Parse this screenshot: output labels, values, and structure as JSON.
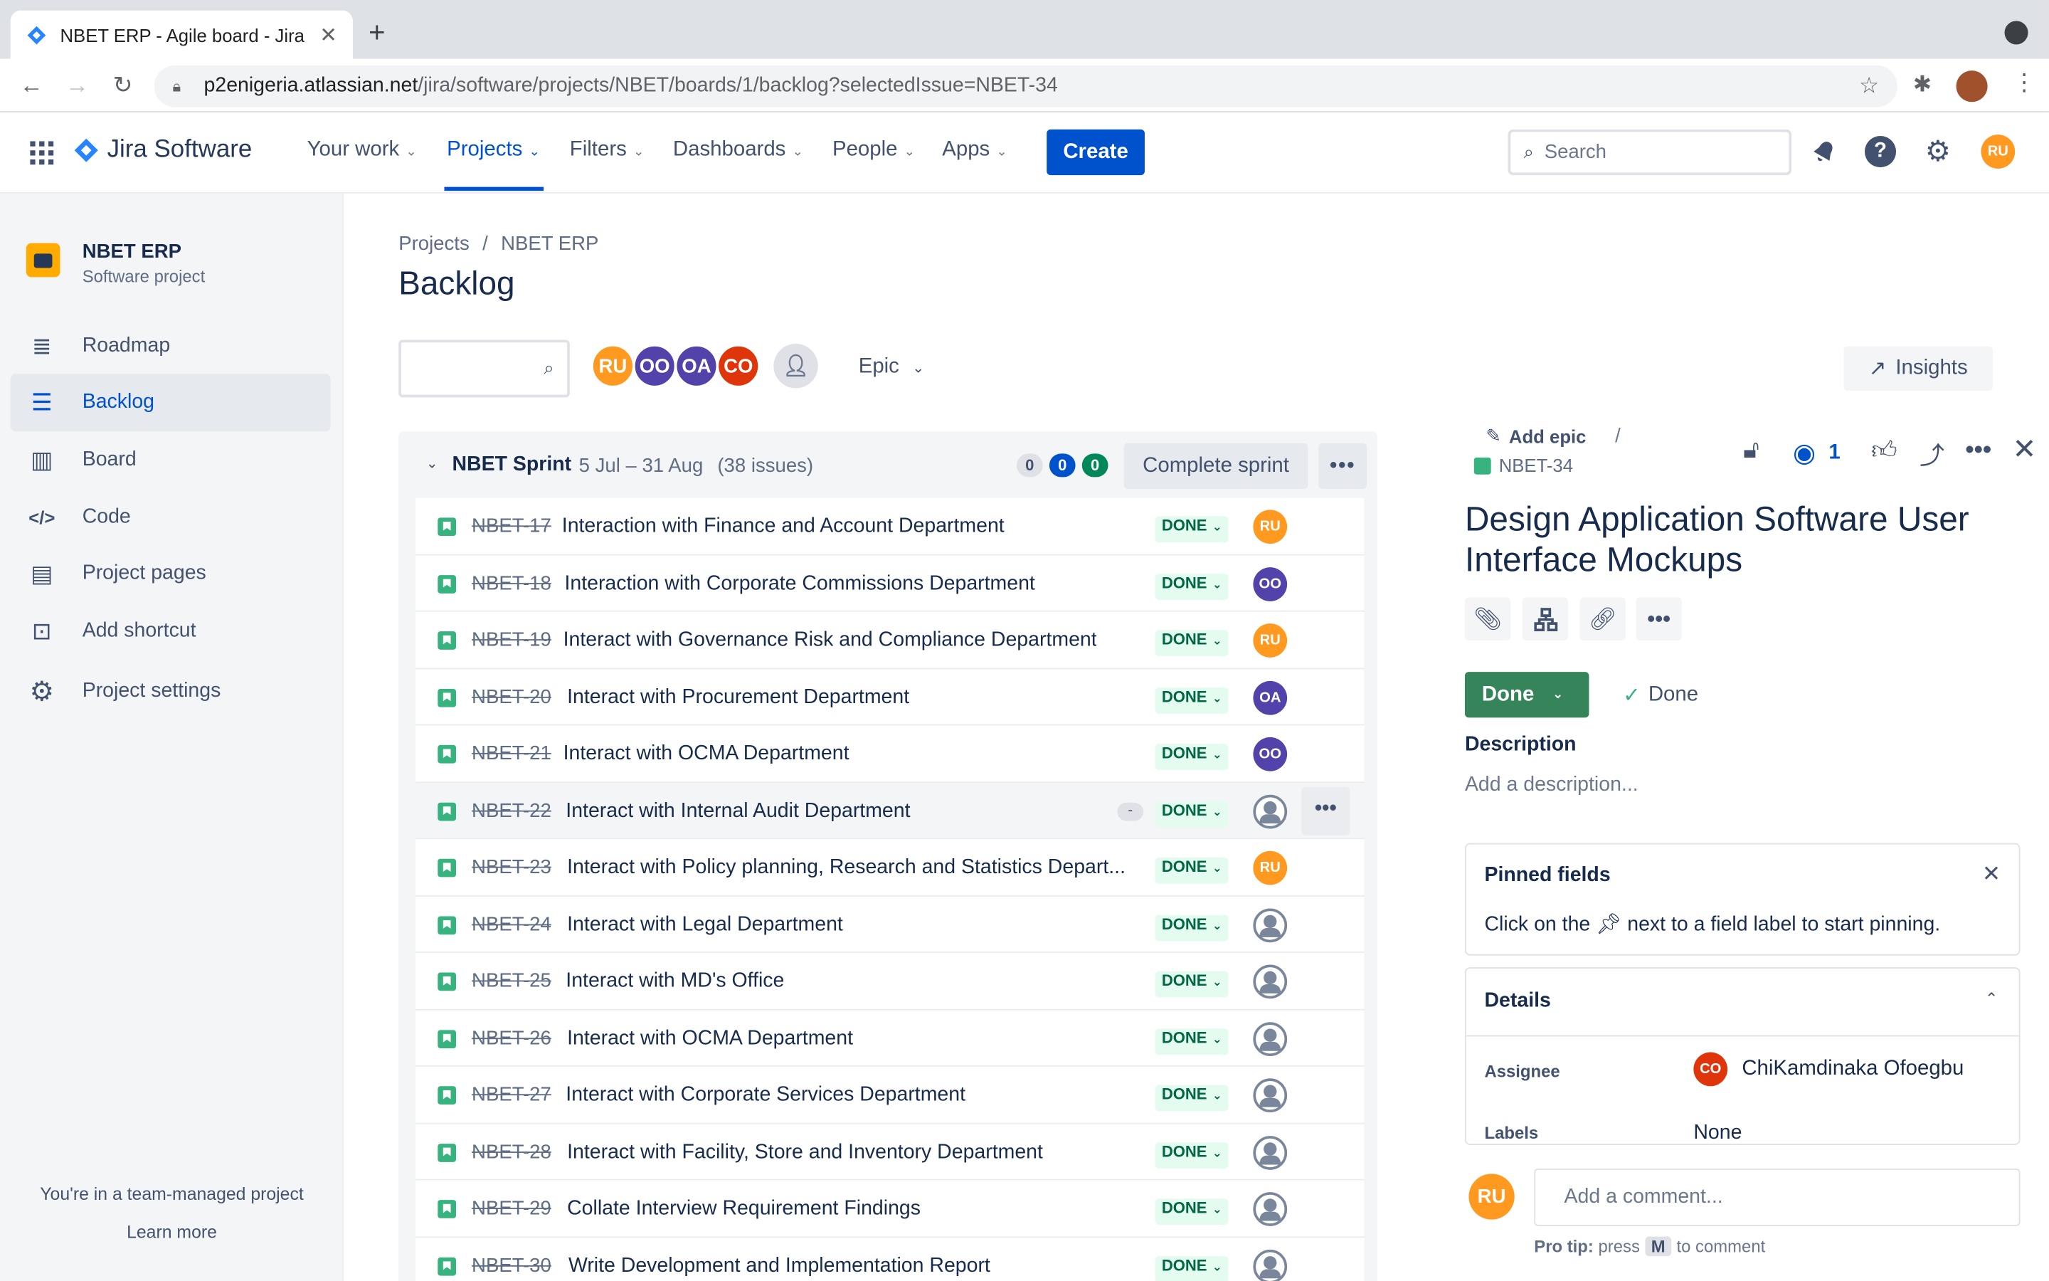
{
  "browser": {
    "tab_title": "NBET ERP - Agile board - Jira",
    "url_host": "p2enigeria.atlassian.net",
    "url_path": "/jira/software/projects/NBET/boards/1/backlog?selectedIssue=NBET-34"
  },
  "nav": {
    "product": "Jira Software",
    "your_work": "Your work",
    "projects": "Projects",
    "filters": "Filters",
    "dashboards": "Dashboards",
    "people": "People",
    "apps": "Apps",
    "create": "Create",
    "search_placeholder": "Search",
    "user_initials": "RU"
  },
  "sidebar": {
    "project_name": "NBET ERP",
    "project_type": "Software project",
    "items": [
      {
        "label": "Roadmap"
      },
      {
        "label": "Backlog"
      },
      {
        "label": "Board"
      },
      {
        "label": "Code"
      },
      {
        "label": "Project pages"
      },
      {
        "label": "Add shortcut"
      },
      {
        "label": "Project settings"
      }
    ],
    "team_note": "You're in a team-managed project",
    "learn_more": "Learn more"
  },
  "main": {
    "breadcrumb": [
      "Projects",
      "NBET ERP"
    ],
    "title": "Backlog",
    "filter_avatars": [
      {
        "initials": "RU",
        "color": "#ff991f"
      },
      {
        "initials": "OO",
        "color": "#5243aa"
      },
      {
        "initials": "OA",
        "color": "#5243aa"
      },
      {
        "initials": "CO",
        "color": "#de350b"
      }
    ],
    "epic_filter": "Epic",
    "insights": "Insights"
  },
  "sprint": {
    "name": "NBET Sprint",
    "dates": "5 Jul – 31 Aug",
    "count": "(38 issues)",
    "counts": [
      "0",
      "0",
      "0"
    ],
    "complete_label": "Complete sprint",
    "status_label": "DONE",
    "issues": [
      {
        "key": "NBET-17",
        "summary": "Interaction with Finance and Account Department",
        "assignee": "RU"
      },
      {
        "key": "NBET-18",
        "summary": "Interaction with Corporate Commissions Department",
        "assignee": "OO"
      },
      {
        "key": "NBET-19",
        "summary": "Interact with Governance Risk and Compliance Department",
        "assignee": "RU"
      },
      {
        "key": "NBET-20",
        "summary": "Interact with Procurement Department",
        "assignee": "OA"
      },
      {
        "key": "NBET-21",
        "summary": "Interact with OCMA Department",
        "assignee": "OO"
      },
      {
        "key": "NBET-22",
        "summary": "Interact with Internal Audit Department",
        "assignee": ""
      },
      {
        "key": "NBET-23",
        "summary": "Interact with Policy planning, Research and Statistics Depart...",
        "assignee": "RU"
      },
      {
        "key": "NBET-24",
        "summary": "Interact with Legal Department",
        "assignee": ""
      },
      {
        "key": "NBET-25",
        "summary": "Interact with MD's Office",
        "assignee": ""
      },
      {
        "key": "NBET-26",
        "summary": "Interact with OCMA Department",
        "assignee": ""
      },
      {
        "key": "NBET-27",
        "summary": "Interact with Corporate Services Department",
        "assignee": ""
      },
      {
        "key": "NBET-28",
        "summary": "Interact with Facility, Store and Inventory Department",
        "assignee": ""
      },
      {
        "key": "NBET-29",
        "summary": "Collate Interview Requirement Findings",
        "assignee": ""
      },
      {
        "key": "NBET-30",
        "summary": "Write Development and Implementation Report",
        "assignee": ""
      }
    ]
  },
  "issue": {
    "add_epic": "Add epic",
    "key": "NBET-34",
    "watchers": "1",
    "title": "Design Application Software User Interface Mockups",
    "status": "Done",
    "resolution": "Done",
    "description_label": "Description",
    "description_placeholder": "Add a description...",
    "pinned_title": "Pinned fields",
    "pinned_pre": "Click on the",
    "pinned_post": "next to a field label to start pinning.",
    "details_title": "Details",
    "assignee_label": "Assignee",
    "assignee_name": "ChiKamdinaka Ofoegbu",
    "assignee_initials": "CO",
    "labels_label": "Labels",
    "labels_value": "None",
    "comment_placeholder": "Add a comment...",
    "commenter_initials": "RU",
    "protip_label": "Pro tip:",
    "protip_press": "press",
    "protip_key": "M",
    "protip_rest": "to comment"
  },
  "colors": {
    "RU": "#ff991f",
    "OO": "#5243aa",
    "OA": "#5243aa",
    "CO": "#de350b"
  }
}
